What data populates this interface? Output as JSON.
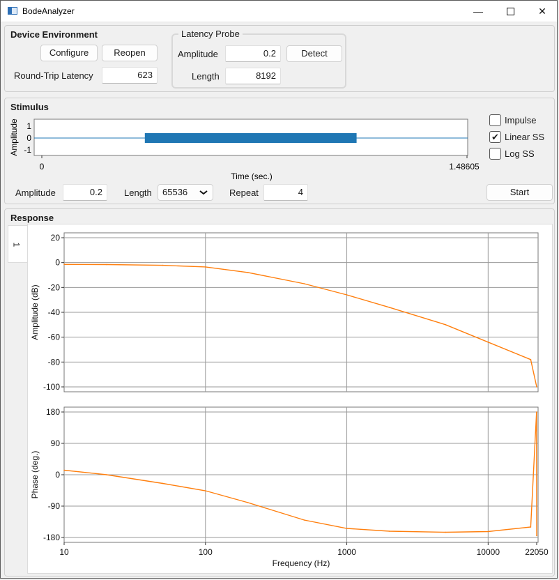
{
  "window": {
    "title": "BodeAnalyzer",
    "minimize_glyph": "—",
    "close_glyph": "✕"
  },
  "device": {
    "title": "Device Environment",
    "configure": "Configure",
    "reopen": "Reopen",
    "rtl_label": "Round-Trip Latency",
    "rtl_value": "623"
  },
  "probe": {
    "title": "Latency Probe",
    "amp_label": "Amplitude",
    "amp_value": "0.2",
    "detect": "Detect",
    "len_label": "Length",
    "len_value": "8192"
  },
  "stimulus": {
    "title": "Stimulus",
    "ylabel": "Amplitude",
    "xlabel": "Time (sec.)",
    "xtick_start": "0",
    "xtick_end": "1.48605",
    "yticks": [
      "1",
      "0",
      "-1"
    ],
    "options": [
      {
        "label": "Impulse",
        "checked": false
      },
      {
        "label": "Linear SS",
        "checked": true
      },
      {
        "label": "Log SS",
        "checked": false
      }
    ],
    "check_glyph": "✔",
    "amp_label": "Amplitude",
    "amp_value": "0.2",
    "len_label": "Length",
    "len_value": "65536",
    "repeat_label": "Repeat",
    "repeat_value": "4",
    "start": "Start",
    "burst_start_s": 0.36,
    "burst_end_s": 1.1
  },
  "response": {
    "title": "Response",
    "tab_label": "1"
  },
  "chart_data": [
    {
      "type": "line",
      "ylabel": "Amplitude (dB)",
      "xscale": "log",
      "xlim": [
        10,
        22050
      ],
      "ylim": [
        -100,
        20
      ],
      "yticks": [
        "20",
        "0",
        "-20",
        "-40",
        "-60",
        "-80",
        "-100"
      ],
      "grid": true,
      "color": "#ff7f0e",
      "x": [
        10,
        20,
        50,
        100,
        200,
        500,
        1000,
        2000,
        5000,
        10000,
        20000,
        22050
      ],
      "y": [
        -1.5,
        -1.6,
        -2.2,
        -3.5,
        -8,
        -17,
        -26,
        -36,
        -50,
        -64,
        -78,
        -100
      ]
    },
    {
      "type": "line",
      "ylabel": "Phase (deg.)",
      "xlabel": "Frequency (Hz)",
      "xscale": "log",
      "xlim": [
        10,
        22050
      ],
      "ylim": [
        -180,
        180
      ],
      "xticks": [
        "10",
        "100",
        "1000",
        "10000",
        "22050"
      ],
      "yticks": [
        "180",
        "90",
        "0",
        "-90",
        "-180"
      ],
      "grid": true,
      "color": "#ff7f0e",
      "x": [
        10,
        20,
        50,
        100,
        200,
        500,
        1000,
        2000,
        5000,
        10000,
        20000,
        22000,
        22050
      ],
      "y": [
        13,
        0,
        -25,
        -46,
        -80,
        -130,
        -154,
        -162,
        -165,
        -163,
        -150,
        180,
        -175
      ]
    }
  ]
}
